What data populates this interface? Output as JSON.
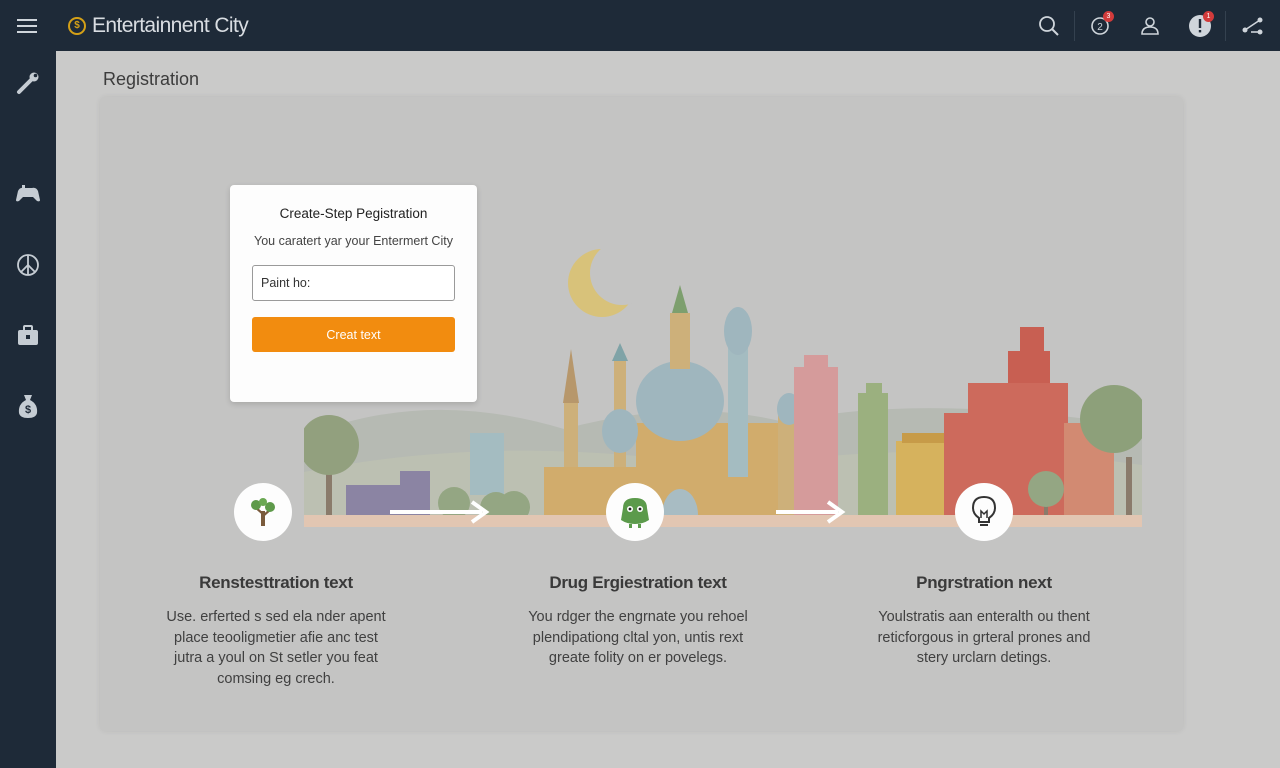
{
  "app": {
    "title": "Entertainnent City",
    "logo_icon": "coin-logo-icon"
  },
  "topbar": {
    "icons": [
      "search-icon",
      "notification-icon",
      "user-icon",
      "alert-icon",
      "share-icon"
    ],
    "notification_badge": "3",
    "alert_badge": "1"
  },
  "sidebar": {
    "items": [
      {
        "icon": "tools-icon"
      },
      {
        "icon": "gamepad-icon"
      },
      {
        "icon": "peace-icon"
      },
      {
        "icon": "briefcase-icon"
      },
      {
        "icon": "money-bag-icon"
      }
    ]
  },
  "page": {
    "title": "Registration"
  },
  "card": {
    "title": "Create-Step Pegistration",
    "subtitle": "You caratert yar your Entermert City",
    "input_placeholder": "Paint ho:",
    "button_label": "Creat text"
  },
  "steps": [
    {
      "icon": "tree-icon",
      "title": "Renstesttration text",
      "description": "Use. erferted s sed ela nder apent\nplace teooligmetier afie anc test\njutra a youl on St setler you feat\ncomsing eg crech."
    },
    {
      "icon": "monster-icon",
      "title": "Drug Ergiestration text",
      "description": "You rdger the engrnate you rehoel\nplendipationg cltal yon, untis rext\ngreate folity on er povelegs."
    },
    {
      "icon": "lightbulb-icon",
      "title": "Pngrstration next",
      "description": "Youlstratis aan enteralth ou thent\nreticforgous in grteral prones and\nstery urclarn detings."
    }
  ],
  "colors": {
    "topbar_bg": "#1e2a38",
    "accent_orange": "#f28c0f",
    "brand_gold": "#d4a017",
    "badge_red": "#d23b3b"
  }
}
